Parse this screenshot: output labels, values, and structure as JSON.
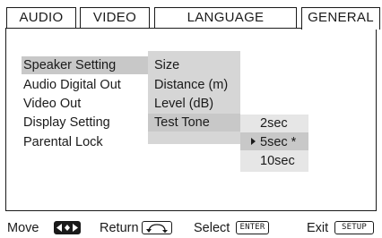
{
  "tabs": [
    {
      "label": "AUDIO"
    },
    {
      "label": "VIDEO"
    },
    {
      "label": "LANGUAGE"
    },
    {
      "label": "GENERAL"
    }
  ],
  "active_tab": "GENERAL",
  "menu": {
    "items": [
      {
        "label": "Speaker Setting"
      },
      {
        "label": "Audio Digital Out"
      },
      {
        "label": "Video Out"
      },
      {
        "label": "Display Setting"
      },
      {
        "label": "Parental Lock"
      }
    ],
    "selected": "Speaker Setting"
  },
  "submenu": {
    "items": [
      {
        "label": "Size"
      },
      {
        "label": "Distance (m)"
      },
      {
        "label": "Level (dB)"
      },
      {
        "label": "Test Tone"
      }
    ],
    "selected": "Test Tone"
  },
  "options": {
    "items": [
      {
        "label": "2sec"
      },
      {
        "label": "5sec *"
      },
      {
        "label": "10sec"
      }
    ],
    "selected": "5sec *"
  },
  "footer": {
    "move_label": "Move",
    "return_label": "Return",
    "select_label": "Select",
    "select_key": "ENTER",
    "exit_label": "Exit",
    "exit_key": "SETUP"
  },
  "icons": {
    "move": "left-right-arrows-icon",
    "return": "return-arrow-icon",
    "selector": "triangle-pointer-icon"
  },
  "colors": {
    "highlight": "#c8c8c8",
    "submenu_bg": "#d6d6d6",
    "options_bg": "#e6e6e6",
    "ink": "#1a1a1a"
  }
}
